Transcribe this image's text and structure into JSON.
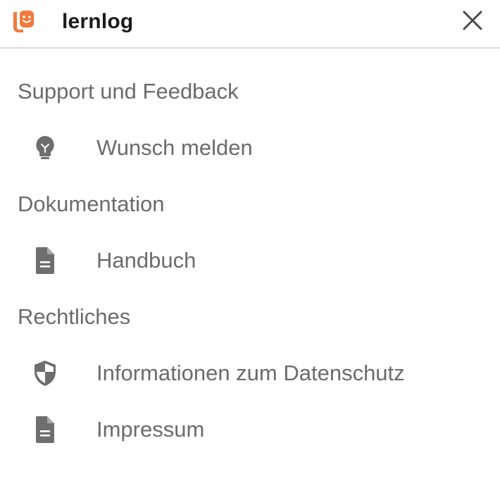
{
  "app": {
    "name": "lernlog",
    "accent_color": "#f07a3c",
    "close_icon": "close-icon"
  },
  "sections": [
    {
      "title": "Support und Feedback",
      "items": [
        {
          "label": "Wunsch melden",
          "icon": "lightbulb-icon"
        }
      ]
    },
    {
      "title": "Dokumentation",
      "items": [
        {
          "label": "Handbuch",
          "icon": "document-icon"
        }
      ]
    },
    {
      "title": "Rechtliches",
      "items": [
        {
          "label": "Informationen zum Datenschutz",
          "icon": "shield-icon"
        },
        {
          "label": "Impressum",
          "icon": "document-icon"
        }
      ]
    }
  ]
}
